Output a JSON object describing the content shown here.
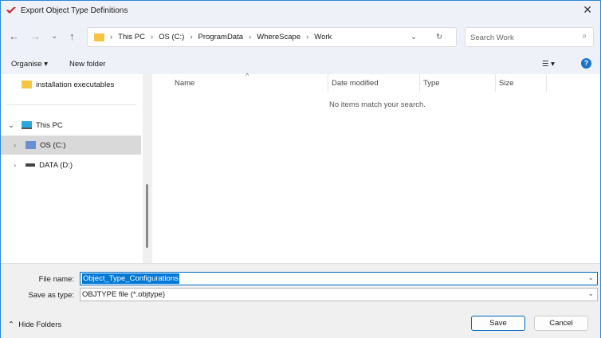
{
  "window": {
    "title": "Export Object Type Definitions"
  },
  "nav": {
    "breadcrumb": [
      "This PC",
      "OS (C:)",
      "ProgramData",
      "WhereScape",
      "Work"
    ],
    "search_placeholder": "Search Work"
  },
  "toolbar": {
    "organise": "Organise",
    "new_folder": "New folder",
    "help": "?"
  },
  "tree": {
    "items": [
      {
        "label": "installation executables"
      },
      {
        "label": "This PC"
      },
      {
        "label": "OS (C:)"
      },
      {
        "label": "DATA (D:)"
      }
    ]
  },
  "columns": [
    "Name",
    "Date modified",
    "Type",
    "Size"
  ],
  "empty_message": "No items match your search.",
  "form": {
    "file_name_label": "File name:",
    "file_name": "Object_Type_Configurations",
    "save_type_label": "Save as type:",
    "save_type": "OBJTYPE file (*.objtype)"
  },
  "footer": {
    "hide_folders": "Hide Folders",
    "save": "Save",
    "cancel": "Cancel"
  },
  "colors": {
    "accent": "#0078d7"
  }
}
